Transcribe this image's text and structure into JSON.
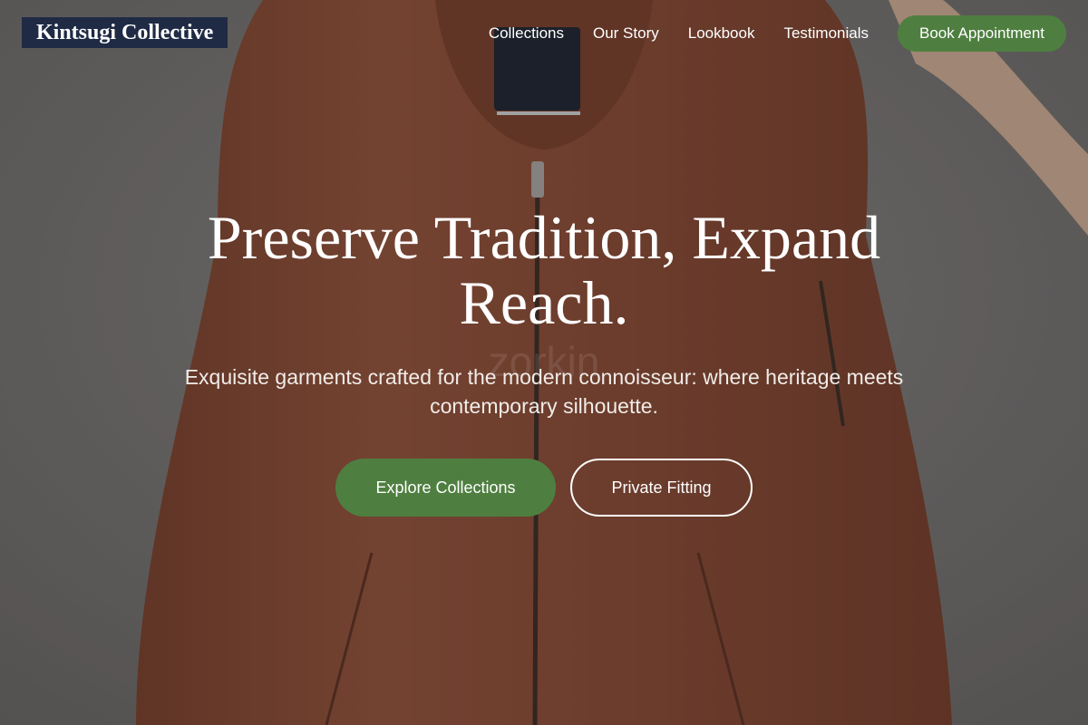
{
  "brand": {
    "name": "Kintsugi Collective"
  },
  "nav": {
    "links": [
      "Collections",
      "Our Story",
      "Lookbook",
      "Testimonials"
    ],
    "cta": "Book Appointment"
  },
  "hero": {
    "title": "Preserve Tradition, Expand Reach.",
    "subtitle": "Exquisite garments crafted for the modern connoisseur: where heritage meets contemporary silhouette.",
    "primary_button": "Explore Collections",
    "secondary_button": "Private Fitting",
    "watermark": "zorkin"
  },
  "colors": {
    "brand_bg": "#1f2a44",
    "accent_green": "#4e7f40",
    "jacket": "#8e4a33"
  }
}
